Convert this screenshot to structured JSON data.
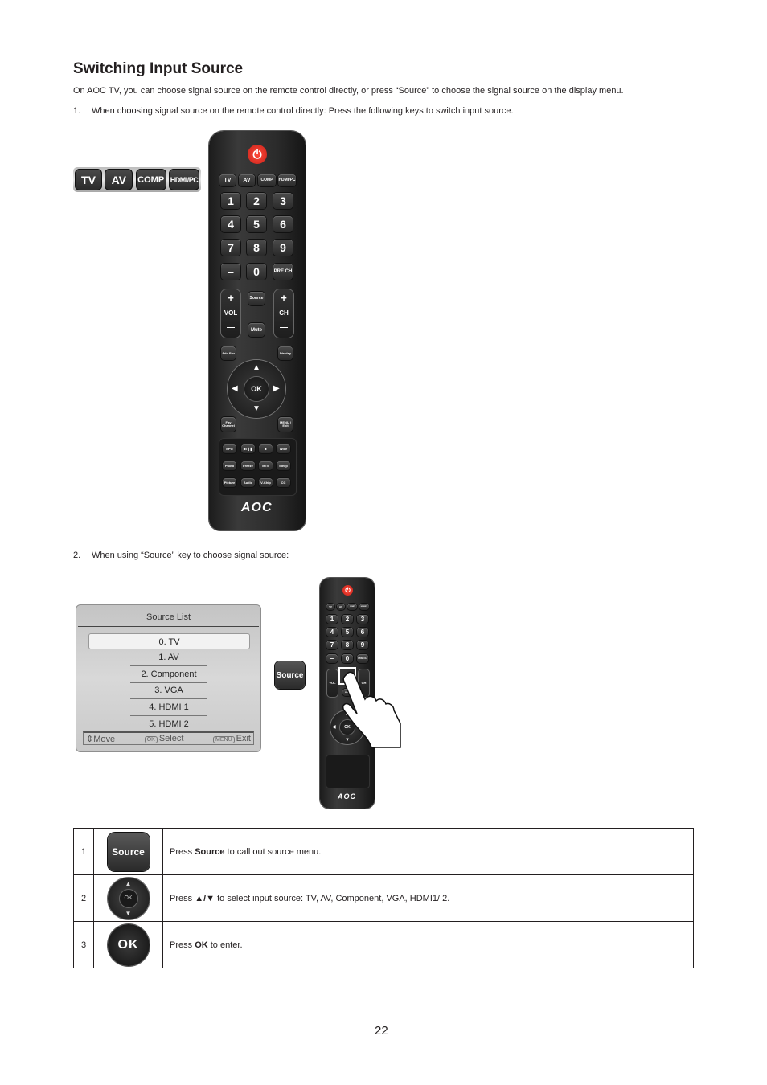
{
  "section_title": "Switching Input Source",
  "intro": "On AOC TV, you can choose signal source on the remote control directly, or press “Source” to choose the signal source on the display menu.",
  "steps_text": [
    {
      "number": "1.",
      "text": "When choosing signal source on the remote control directly: Press the following keys to switch input source."
    },
    {
      "number": "2.",
      "text": "When using “Source” key to choose signal source:"
    }
  ],
  "input_keys": [
    "TV",
    "AV",
    "COMP",
    "HDMI/PC"
  ],
  "remote": {
    "brand": "AOC",
    "power_icon": "⏻",
    "source_keys": [
      "TV",
      "AV",
      "COMP",
      "HDMI/PC"
    ],
    "number_keys": [
      "1",
      "2",
      "3",
      "4",
      "5",
      "6",
      "7",
      "8",
      "9",
      "–",
      "0",
      "PRE CH"
    ],
    "vol_label": "VOL",
    "ch_label": "CH",
    "plus": "+",
    "minus": "—",
    "source_label": "Source",
    "mute_label": "Mute",
    "add_fav_label": "Add Fav",
    "display_label": "Display",
    "ok_label": "OK",
    "fav_channel_label": "Fav Channel",
    "menu_exit_label": "MENU / Exit",
    "arrow_up": "▲",
    "arrow_down": "▼",
    "arrow_left": "◀",
    "arrow_right": "▶",
    "function_keys": [
      "EPG",
      "▶/❚❚",
      "■",
      "Wide",
      "Photo",
      "Freeze",
      "MTS",
      "Sleep",
      "Picture",
      "Audio",
      "V-Chip",
      "CC"
    ]
  },
  "source_menu": {
    "title": "Source List",
    "items": [
      "0. TV",
      "1. AV",
      "2. Component",
      "3. VGA",
      "4. HDMI 1",
      "5. HDMI 2"
    ],
    "selected_index": 0,
    "footer": {
      "move_icon": "⇕",
      "move_label": "Move",
      "select_badge": "OK",
      "select_label": "Select",
      "exit_badge": "MENU",
      "exit_label": "Exit"
    }
  },
  "source_button_label": "Source",
  "table": {
    "rows": [
      {
        "index": "1",
        "icon": "source-button",
        "icon_label": "Source",
        "pre": "Press ",
        "bold": "Source",
        "post": " to call out source menu."
      },
      {
        "index": "2",
        "icon": "dpad-updown",
        "icon_label": "OK",
        "pre": "Press ",
        "bold": "▲/▼",
        "post": " to select input source: TV, AV, Component, VGA, HDMI1/ 2."
      },
      {
        "index": "3",
        "icon": "ok-button",
        "icon_label": "OK",
        "pre": "Press ",
        "bold": "OK",
        "post": " to enter."
      }
    ]
  },
  "page_number": "22"
}
